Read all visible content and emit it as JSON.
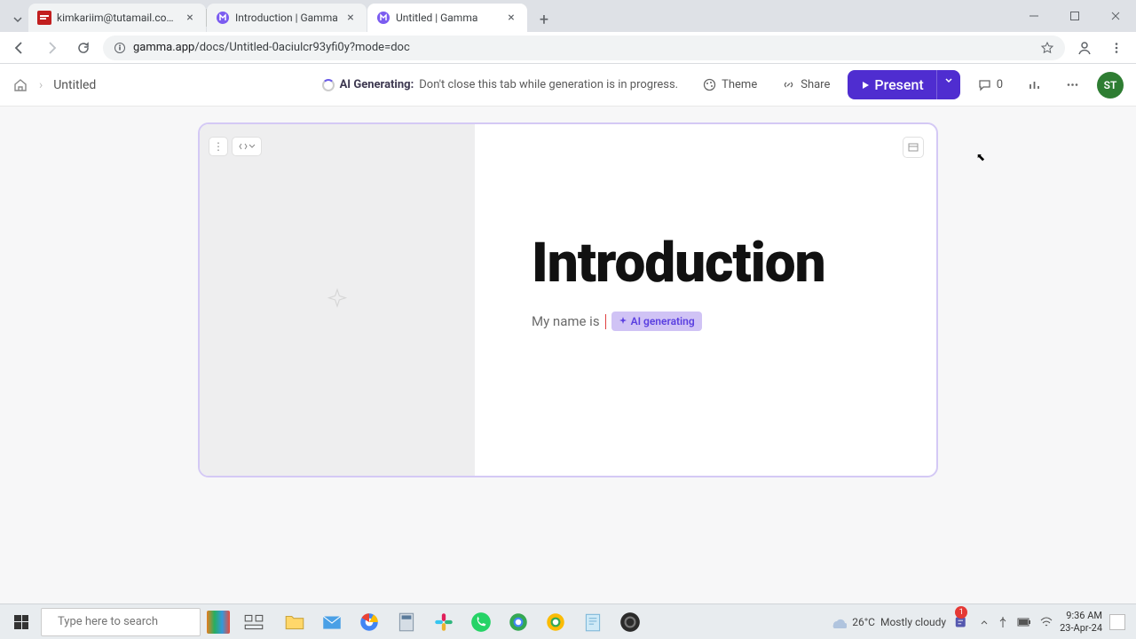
{
  "browser": {
    "tabs": [
      {
        "title": "kimkariim@tutamail.com - Tu",
        "favicon": "tuta"
      },
      {
        "title": "Introduction | Gamma",
        "favicon": "gamma"
      },
      {
        "title": "Untitled | Gamma",
        "favicon": "gamma"
      }
    ],
    "url_prefix": "gamma.app",
    "url_path": "/docs/Untitled-0aciulcr93yfi0y?mode=doc"
  },
  "header": {
    "doc_title": "Untitled",
    "ai_label": "AI Generating:",
    "ai_message": "Don't close this tab while generation is in progress.",
    "theme": "Theme",
    "share": "Share",
    "present": "Present",
    "comment_count": "0",
    "avatar": "ST"
  },
  "slide": {
    "title": "Introduction",
    "body": "My name is",
    "ai_tag": "AI generating"
  },
  "taskbar": {
    "search_placeholder": "Type here to search",
    "weather_temp": "26°C",
    "weather_text": "Mostly cloudy",
    "time": "9:36 AM",
    "date": "23-Apr-24",
    "teams_badge": "1"
  }
}
